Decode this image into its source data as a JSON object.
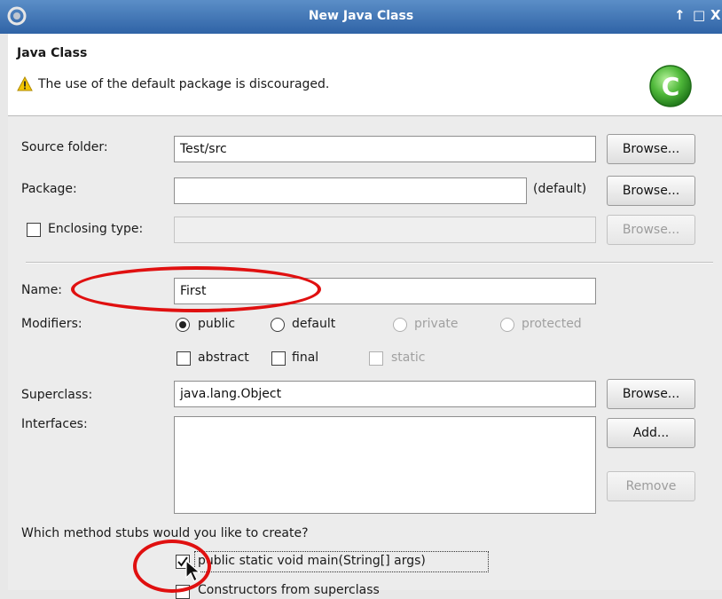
{
  "window": {
    "title": "New Java Class",
    "controls": {
      "up": "↑",
      "maximize": "□",
      "close": "X"
    }
  },
  "header": {
    "title": "Java Class",
    "warning": "The use of the default package is discouraged.",
    "logo_letter": "C"
  },
  "form": {
    "source_folder": {
      "label": "Source folder:",
      "value": "Test/src",
      "browse": "Browse..."
    },
    "package": {
      "label": "Package:",
      "value": "",
      "hint": "(default)",
      "browse": "Browse..."
    },
    "enclosing_type": {
      "label": "Enclosing type:",
      "value": "",
      "browse": "Browse...",
      "checked": false
    },
    "name": {
      "label": "Name:",
      "value": "First"
    },
    "modifiers": {
      "label": "Modifiers:",
      "options": [
        "public",
        "default",
        "private",
        "protected"
      ],
      "selected": "public",
      "checks": [
        "abstract",
        "final",
        "static"
      ]
    },
    "superclass": {
      "label": "Superclass:",
      "value": "java.lang.Object",
      "browse": "Browse..."
    },
    "interfaces": {
      "label": "Interfaces:",
      "add": "Add...",
      "remove": "Remove"
    },
    "stubs": {
      "question": "Which method stubs would you like to create?",
      "main": "public static void main(String[] args)",
      "main_checked": true,
      "constructors": "Constructors from superclass"
    }
  },
  "colors": {
    "titlebar": "#3a6fb0",
    "annotation": "#e01010",
    "warning": "#f2c500",
    "logo_green": "#4fb83a"
  }
}
